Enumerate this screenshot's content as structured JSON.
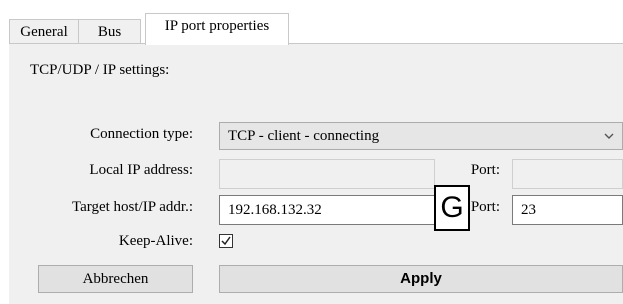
{
  "tabs": [
    {
      "label": "General",
      "active": false
    },
    {
      "label": "Bus",
      "active": false
    },
    {
      "label": "IP port properties",
      "active": true
    }
  ],
  "section_title": "TCP/UDP / IP settings:",
  "form": {
    "connection_type_label": "Connection type:",
    "connection_type_value": "TCP - client - connecting",
    "local_ip_label": "Local IP address:",
    "local_ip_value": "",
    "local_port_label": "Port:",
    "local_port_value": "",
    "target_host_label": "Target host/IP addr.:",
    "target_host_value": "192.168.132.32",
    "target_port_label": "Port:",
    "target_port_value": "23",
    "keepalive_label": "Keep-Alive:",
    "keepalive_checked": true
  },
  "buttons": {
    "cancel_label": "Abbrechen",
    "apply_label": "Apply"
  },
  "marker": {
    "label": "G"
  },
  "colors": {
    "panel": "#f0f0f0",
    "field_border": "#7a7a7a"
  }
}
